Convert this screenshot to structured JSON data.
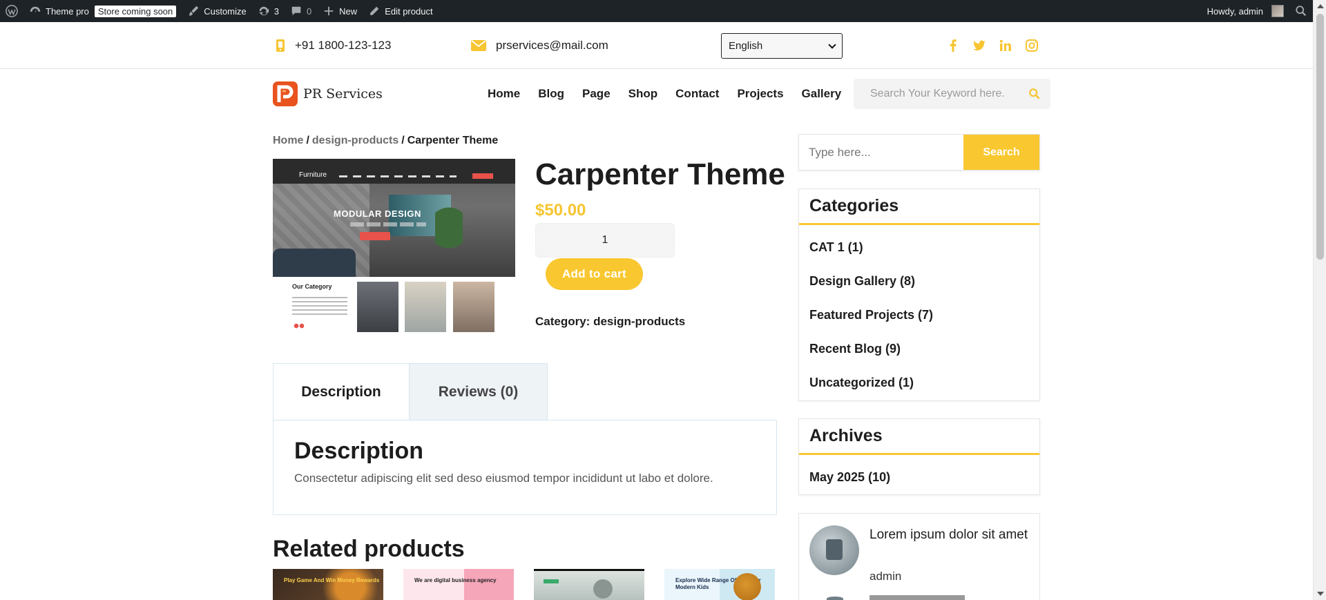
{
  "adminbar": {
    "site_name": "Theme pro",
    "store_badge": "Store coming soon",
    "customize": "Customize",
    "updates_count": "3",
    "comments_count": "0",
    "new_label": "New",
    "edit_label": "Edit product",
    "howdy": "Howdy, admin"
  },
  "topbar": {
    "phone": "+91 1800-123-123",
    "email": "prservices@mail.com",
    "language": "English"
  },
  "header": {
    "logo_text": "PR Services",
    "nav": [
      "Home",
      "Blog",
      "Page",
      "Shop",
      "Contact",
      "Projects",
      "Gallery"
    ],
    "search_placeholder": "Search Your Keyword here."
  },
  "breadcrumb": {
    "home": "Home",
    "sep": "/",
    "category": "design-products",
    "current": "Carpenter Theme"
  },
  "product": {
    "title": "Carpenter Theme",
    "price": "$50.00",
    "quantity": "1",
    "add_to_cart": "Add to cart",
    "category_label": "Category: design-products",
    "image": {
      "brand": "Furniture",
      "hero_title": "MODULAR DESIGN",
      "category_title": "Our Category"
    }
  },
  "tabs": {
    "description_tab": "Description",
    "reviews_tab": "Reviews (0)",
    "panel_heading": "Description",
    "panel_text": "Consectetur adipiscing elit sed deso eiusmod tempor incididunt ut labo et dolore."
  },
  "related": {
    "heading": "Related products",
    "items": [
      {
        "caption": "Play Game And Win Money Rewards"
      },
      {
        "caption": "We are digital business agency"
      },
      {
        "caption": ""
      },
      {
        "caption": "Explore Wide Range Of Toys For Modern Kids"
      }
    ]
  },
  "sidebar": {
    "search_placeholder": "Type here...",
    "search_button": "Search",
    "categories": {
      "title": "Categories",
      "items": [
        "CAT 1 (1)",
        "Design Gallery (8)",
        "Featured Projects (7)",
        "Recent Blog (9)",
        "Uncategorized (1)"
      ]
    },
    "archives": {
      "title": "Archives",
      "items": [
        "May 2025 (10)"
      ]
    },
    "recent_post": {
      "title": "Lorem ipsum dolor sit amet",
      "author": "admin"
    }
  },
  "colors": {
    "accent": "#f9c72f",
    "adminbar": "#1d2327"
  }
}
